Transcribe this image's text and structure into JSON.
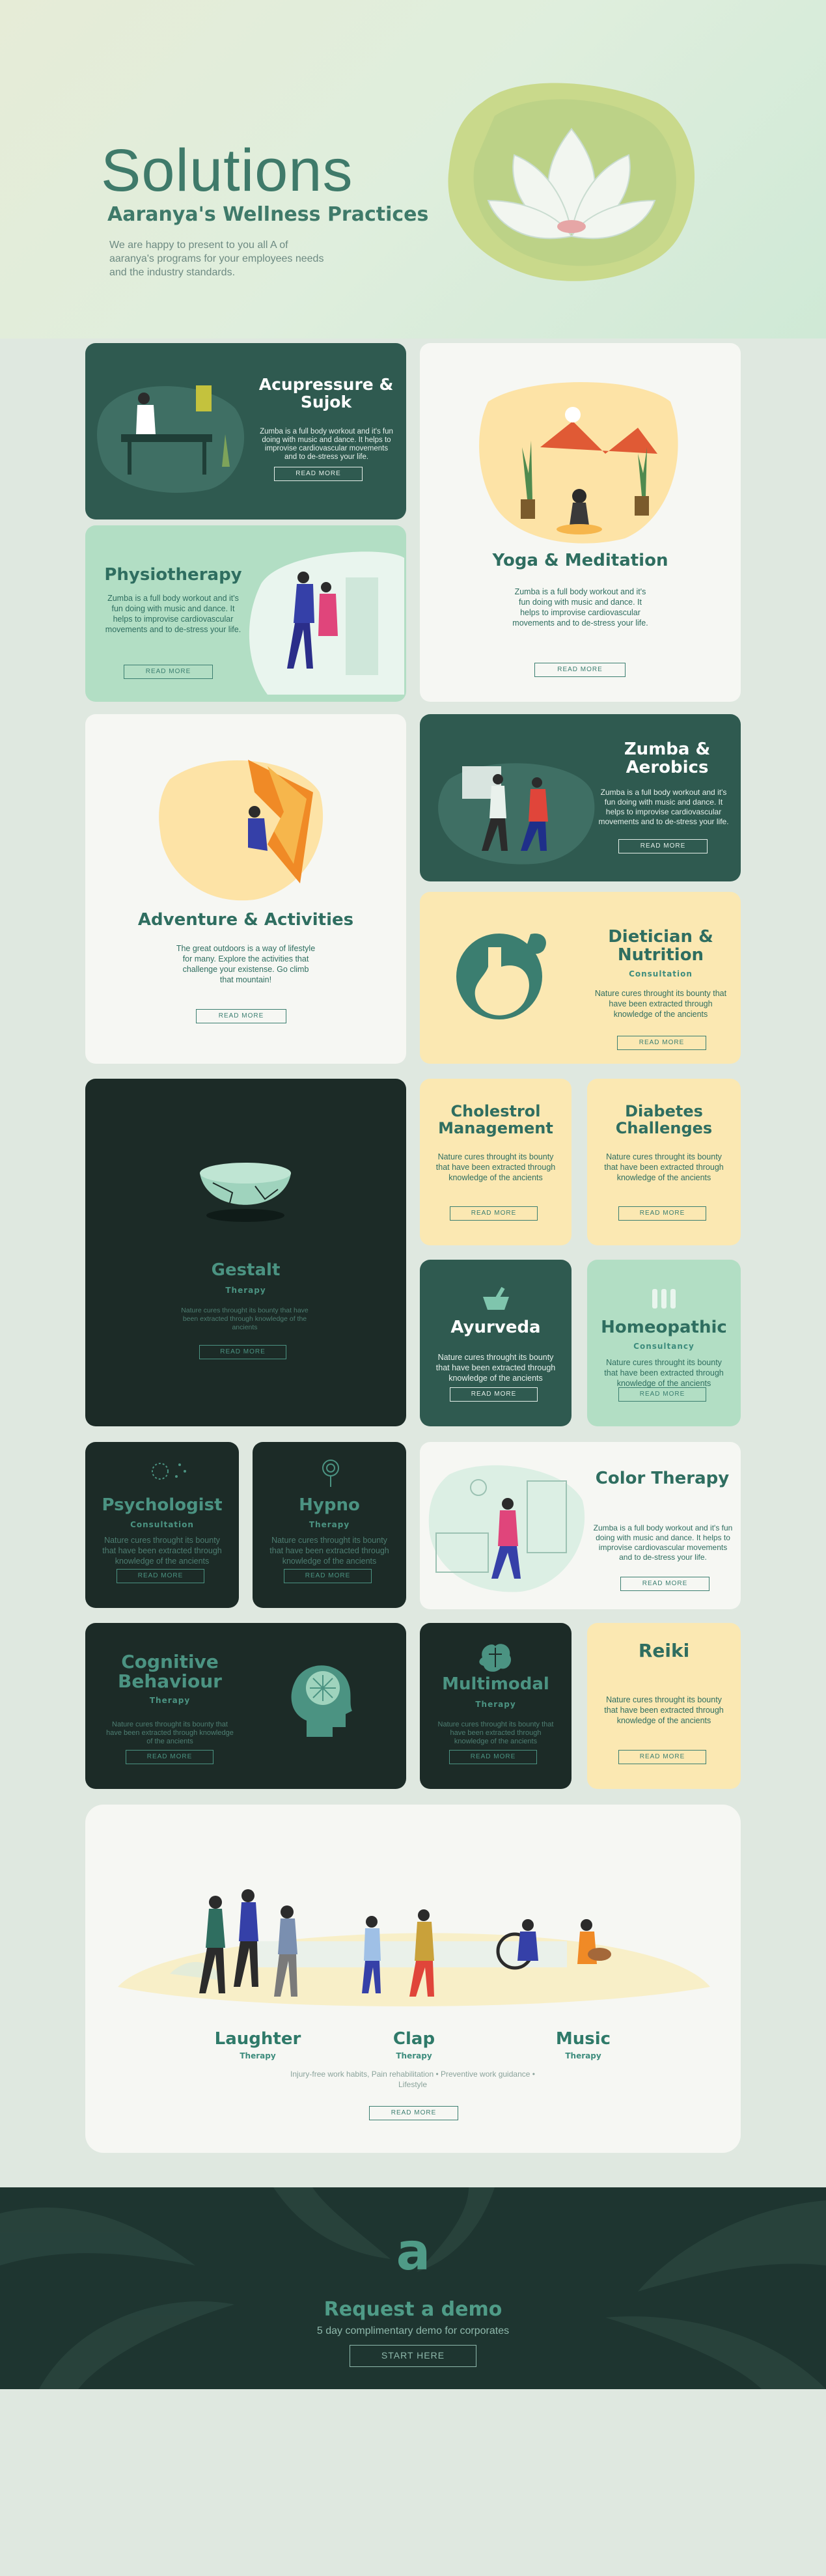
{
  "hero": {
    "title": "Solutions",
    "subtitle": "Aaranya's Wellness Practices",
    "description": "We are happy to present to you all A of aaranya's programs for your employees needs  and the industry standards."
  },
  "cards": {
    "acupressure": {
      "title": "Acupressure & Sujok",
      "desc": "Zumba is a full body workout and it's fun doing with music and dance. It helps to improvise cardiovascular movements and to de-stress your life.",
      "button": "READ MORE"
    },
    "physiotherapy": {
      "title": "Physiotherapy",
      "desc": "Zumba is a full body workout and it's fun doing with music and dance. It helps to improvise cardiovascular movements and to de-stress your life.",
      "button": "READ MORE"
    },
    "yoga": {
      "title": "Yoga & Meditation",
      "desc": "Zumba is a full body workout and it's fun doing with music and dance. It helps to improvise cardiovascular movements and to de-stress your life.",
      "button": "READ MORE"
    },
    "adventure": {
      "title": "Adventure & Activities",
      "desc": "The great outdoors is a way of lifestyle for many. Explore the activities that challenge your existense. Go climb that mountain!",
      "button": "READ MORE"
    },
    "zumba": {
      "title": "Zumba & Aerobics",
      "desc": "Zumba is a full body workout and it's fun doing with music and dance. It helps to improvise cardiovascular movements and to de-stress your life.",
      "button": "READ MORE"
    },
    "dietician": {
      "title": "Dietician & Nutrition",
      "sub": "Consultation",
      "desc": "Nature cures throught its bounty that have been extracted through knowledge of the ancients",
      "button": "READ MORE"
    },
    "gestalt": {
      "title": "Gestalt",
      "sub": "Therapy",
      "desc": "Nature cures throught its bounty that have been extracted through knowledge of the ancients",
      "button": "READ MORE"
    },
    "cholestrol": {
      "title": "Cholestrol Management",
      "desc": "Nature cures throught its bounty that have been extracted through knowledge of the ancients",
      "button": "READ MORE"
    },
    "diabetes": {
      "title": "Diabetes Challenges",
      "desc": "Nature cures throught its bounty that have been extracted through knowledge of the ancients",
      "button": "READ MORE"
    },
    "ayurveda": {
      "title": "Ayurveda",
      "desc": "Nature cures throught its bounty that have been extracted through knowledge of the ancients",
      "button": "READ MORE"
    },
    "homeopathic": {
      "title": "Homeopathic",
      "sub": "Consultancy",
      "desc": "Nature cures throught its bounty that have been extracted through knowledge of the ancients",
      "button": "READ MORE"
    },
    "psychologist": {
      "title": "Psychologist",
      "sub": "Consultation",
      "desc": "Nature cures throught its bounty that have been extracted through knowledge of the ancients",
      "button": "READ MORE"
    },
    "hypno": {
      "title": "Hypno",
      "sub": "Therapy",
      "desc": "Nature cures throught its bounty that have been extracted through knowledge of the ancients",
      "button": "READ MORE"
    },
    "color": {
      "title": "Color Therapy",
      "desc": "Zumba is a full body workout and it's fun doing with music and dance. It helps to improvise cardiovascular movements and to de-stress your life.",
      "button": "READ MORE"
    },
    "cognitive": {
      "title": "Cognitive Behaviour",
      "sub": "Therapy",
      "desc": "Nature cures throught its bounty that have been extracted through knowledge of the ancients",
      "button": "READ MORE"
    },
    "multimodal": {
      "title": "Multimodal",
      "sub": "Therapy",
      "desc": "Nature cures throught its bounty that have been extracted through knowledge of the ancients",
      "button": "READ MORE"
    },
    "reiki": {
      "title": "Reiki",
      "desc": "Nature cures throught its bounty that have been extracted through knowledge of the ancients",
      "button": "READ MORE"
    }
  },
  "group": {
    "words": [
      {
        "title": "Laughter",
        "sub": "Therapy"
      },
      {
        "title": "Clap",
        "sub": "Therapy"
      },
      {
        "title": "Music",
        "sub": "Therapy"
      }
    ],
    "desc": "Injury-free work habits, Pain rehabilitation  •  Preventive work guidance  •  Lifestyle",
    "button": "READ MORE"
  },
  "footer": {
    "logo": "a",
    "title": "Request a demo",
    "subtitle": "5 day complimentary demo for corporates",
    "button": "START HERE"
  },
  "colors": {
    "dark": "#2f5a50",
    "darker": "#1c2b27",
    "mint": "#b2dec4",
    "cream": "#fbe8b2",
    "accent": "#3f7a6a"
  }
}
